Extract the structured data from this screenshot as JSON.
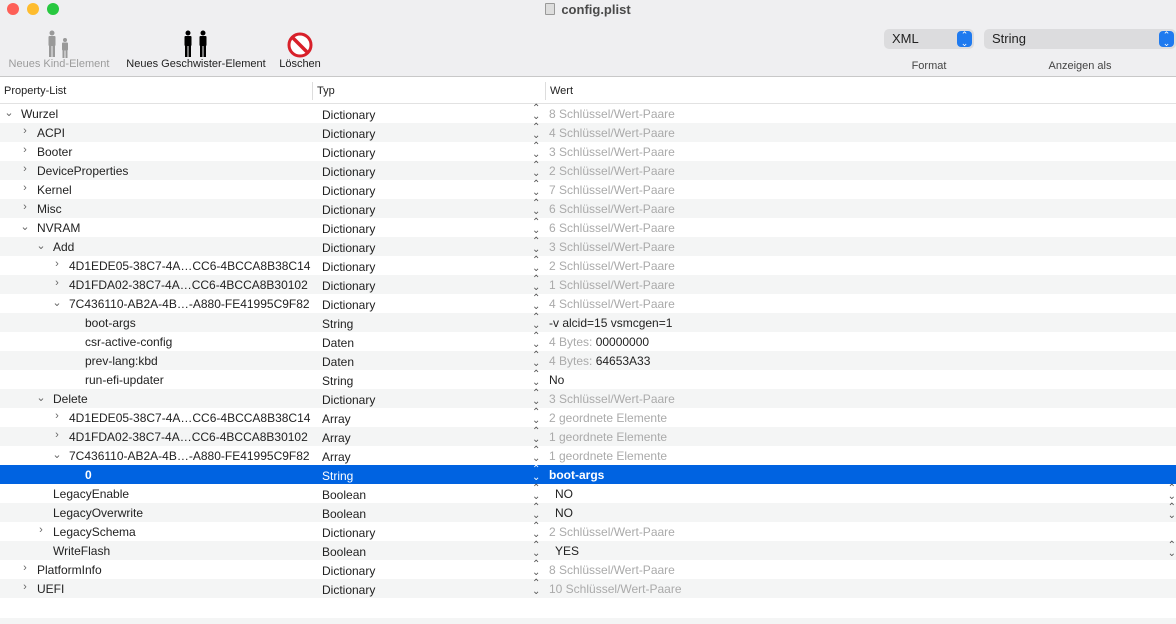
{
  "window": {
    "title": "config.plist"
  },
  "toolbar": {
    "new_child": "Neues Kind-Element",
    "new_sibling": "Neues Geschwister-Element",
    "delete": "Löschen",
    "format_value": "XML",
    "format_label": "Format",
    "show_as_value": "String",
    "show_as_label": "Anzeigen als"
  },
  "columns": {
    "key": "Property-List",
    "type": "Typ",
    "value": "Wert"
  },
  "colors": {
    "selection": "#0063e1",
    "accent": "#1f7aef"
  },
  "rows": [
    {
      "depth": 0,
      "disc": "open",
      "key": "Wurzel",
      "type": "Dictionary",
      "pre": "",
      "value": "8 Schlüssel/Wert-Paare",
      "dim": true
    },
    {
      "depth": 1,
      "disc": "closed",
      "key": "ACPI",
      "type": "Dictionary",
      "pre": "",
      "value": "4 Schlüssel/Wert-Paare",
      "dim": true
    },
    {
      "depth": 1,
      "disc": "closed",
      "key": "Booter",
      "type": "Dictionary",
      "pre": "",
      "value": "3 Schlüssel/Wert-Paare",
      "dim": true
    },
    {
      "depth": 1,
      "disc": "closed",
      "key": "DeviceProperties",
      "type": "Dictionary",
      "pre": "",
      "value": "2 Schlüssel/Wert-Paare",
      "dim": true
    },
    {
      "depth": 1,
      "disc": "closed",
      "key": "Kernel",
      "type": "Dictionary",
      "pre": "",
      "value": "7 Schlüssel/Wert-Paare",
      "dim": true
    },
    {
      "depth": 1,
      "disc": "closed",
      "key": "Misc",
      "type": "Dictionary",
      "pre": "",
      "value": "6 Schlüssel/Wert-Paare",
      "dim": true
    },
    {
      "depth": 1,
      "disc": "open",
      "key": "NVRAM",
      "type": "Dictionary",
      "pre": "",
      "value": "6 Schlüssel/Wert-Paare",
      "dim": true
    },
    {
      "depth": 2,
      "disc": "open",
      "key": "Add",
      "type": "Dictionary",
      "pre": "",
      "value": "3 Schlüssel/Wert-Paare",
      "dim": true
    },
    {
      "depth": 3,
      "disc": "closed",
      "key": "4D1EDE05-38C7-4A…CC6-4BCCA8B38C14",
      "type": "Dictionary",
      "pre": "",
      "value": "2 Schlüssel/Wert-Paare",
      "dim": true
    },
    {
      "depth": 3,
      "disc": "closed",
      "key": "4D1FDA02-38C7-4A…CC6-4BCCA8B30102",
      "type": "Dictionary",
      "pre": "",
      "value": "1 Schlüssel/Wert-Paare",
      "dim": true
    },
    {
      "depth": 3,
      "disc": "open",
      "key": "7C436110-AB2A-4B…-A880-FE41995C9F82",
      "type": "Dictionary",
      "pre": "",
      "value": "4 Schlüssel/Wert-Paare",
      "dim": true
    },
    {
      "depth": 4,
      "disc": "none",
      "key": "boot-args",
      "type": "String",
      "pre": "",
      "value": "-v alcid=15 vsmcgen=1",
      "dim": false
    },
    {
      "depth": 4,
      "disc": "none",
      "key": "csr-active-config",
      "type": "Daten",
      "pre": "4 Bytes: ",
      "value": "00000000",
      "dim": false
    },
    {
      "depth": 4,
      "disc": "none",
      "key": "prev-lang:kbd",
      "type": "Daten",
      "pre": "4 Bytes: ",
      "value": "64653A33",
      "dim": false
    },
    {
      "depth": 4,
      "disc": "none",
      "key": "run-efi-updater",
      "type": "String",
      "pre": "",
      "value": "No",
      "dim": false
    },
    {
      "depth": 2,
      "disc": "open",
      "key": "Delete",
      "type": "Dictionary",
      "pre": "",
      "value": "3 Schlüssel/Wert-Paare",
      "dim": true
    },
    {
      "depth": 3,
      "disc": "closed",
      "key": "4D1EDE05-38C7-4A…CC6-4BCCA8B38C14",
      "type": "Array",
      "pre": "",
      "value": "2 geordnete Elemente",
      "dim": true
    },
    {
      "depth": 3,
      "disc": "closed",
      "key": "4D1FDA02-38C7-4A…CC6-4BCCA8B30102",
      "type": "Array",
      "pre": "",
      "value": "1 geordnete Elemente",
      "dim": true
    },
    {
      "depth": 3,
      "disc": "open",
      "key": "7C436110-AB2A-4B…-A880-FE41995C9F82",
      "type": "Array",
      "pre": "",
      "value": "1 geordnete Elemente",
      "dim": true
    },
    {
      "depth": 4,
      "disc": "none",
      "key": "0",
      "type": "String",
      "pre": "",
      "value": "boot-args",
      "dim": false,
      "selected": true
    },
    {
      "depth": 2,
      "disc": "none",
      "key": "LegacyEnable",
      "type": "Boolean",
      "pre": "",
      "value": "NO",
      "dim": false,
      "bool": true
    },
    {
      "depth": 2,
      "disc": "none",
      "key": "LegacyOverwrite",
      "type": "Boolean",
      "pre": "",
      "value": "NO",
      "dim": false,
      "bool": true
    },
    {
      "depth": 2,
      "disc": "closed",
      "key": "LegacySchema",
      "type": "Dictionary",
      "pre": "",
      "value": "2 Schlüssel/Wert-Paare",
      "dim": true
    },
    {
      "depth": 2,
      "disc": "none",
      "key": "WriteFlash",
      "type": "Boolean",
      "pre": "",
      "value": "YES",
      "dim": false,
      "bool": true
    },
    {
      "depth": 1,
      "disc": "closed",
      "key": "PlatformInfo",
      "type": "Dictionary",
      "pre": "",
      "value": "8 Schlüssel/Wert-Paare",
      "dim": true
    },
    {
      "depth": 1,
      "disc": "closed",
      "key": "UEFI",
      "type": "Dictionary",
      "pre": "",
      "value": "10 Schlüssel/Wert-Paare",
      "dim": true
    }
  ]
}
